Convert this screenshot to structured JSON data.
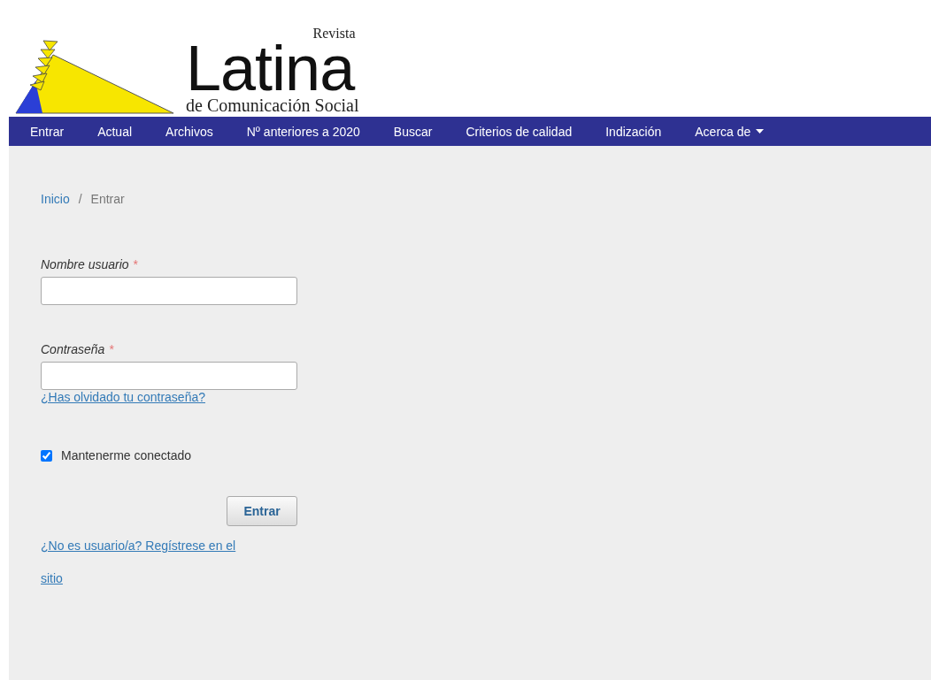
{
  "logo": {
    "small": "Revista",
    "main": "Latina",
    "sub": "de Comunicación Social"
  },
  "nav": [
    {
      "label": "Entrar",
      "dropdown": false
    },
    {
      "label": "Actual",
      "dropdown": false
    },
    {
      "label": "Archivos",
      "dropdown": false
    },
    {
      "label": "Nº anteriores a 2020",
      "dropdown": false
    },
    {
      "label": "Buscar",
      "dropdown": false
    },
    {
      "label": "Criterios de calidad",
      "dropdown": false
    },
    {
      "label": "Indización",
      "dropdown": false
    },
    {
      "label": "Acerca de",
      "dropdown": true
    }
  ],
  "breadcrumb": {
    "home": "Inicio",
    "separator": "/",
    "current": "Entrar"
  },
  "fields": [
    {
      "label": "Nombre usuario",
      "required_mark": "*"
    },
    {
      "label": "Contraseña",
      "required_mark": "*"
    }
  ],
  "forgot_link": "¿Has olvidado tu contraseña?",
  "remember": {
    "label": "Mantenerme conectado",
    "checked": true
  },
  "submit": "Entrar",
  "register_link": "¿No es usuario/a? Regístrese en el sitio"
}
